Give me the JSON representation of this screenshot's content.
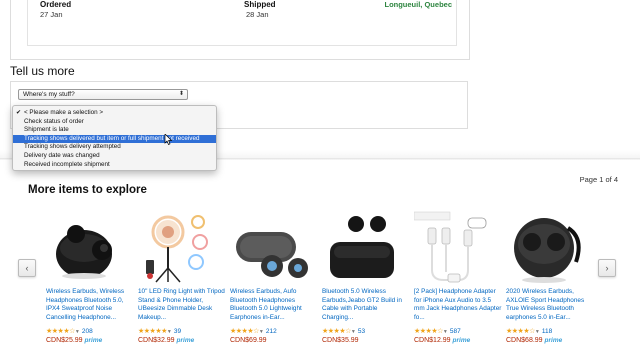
{
  "order": {
    "ordered_label": "Ordered",
    "ordered_value": "27 Jan",
    "shipped_label": "Shipped",
    "shipped_value": "28 Jan",
    "location": "Longueuil, Quebec"
  },
  "tell_us": {
    "title": "Tell us more",
    "select_value": "Where's my stuff?"
  },
  "dropdown": {
    "options": [
      "< Please make a selection >",
      "Check status of order",
      "Shipment is late",
      "Tracking shows delivered but item or full shipment not received",
      "Tracking shows delivery attempted",
      "Delivery date was changed",
      "Received incomplete shipment"
    ],
    "checked_index": 0,
    "highlighted_index": 3
  },
  "explore": {
    "title": "More items to explore",
    "page": "Page 1 of 4",
    "prev": "‹",
    "next": "›"
  },
  "products": [
    {
      "title": "Wireless Earbuds, Wireless Headphones Bluetooth 5.0, IPX4 Sweatproof Noise Cancelling Headphone...",
      "stars": "★★★★☆",
      "rating": 3.5,
      "count": "208",
      "price": "CDN$25.99",
      "prime": "prime",
      "icon": "black-earbuds-case-icon"
    },
    {
      "title": "10\" LED Ring Light with Tripod Stand & Phone Holder, UBeesize Dimmable Desk Makeup...",
      "stars": "★★★★★",
      "rating": 4.5,
      "count": "39",
      "price": "CDN$32.99",
      "prime": "prime",
      "icon": "ring-light-tripod-icon"
    },
    {
      "title": "Wireless Earbuds, Aufo Bluetooth Headphones Bluetooth 5.0 Lightweight Earphones in-Ear...",
      "stars": "★★★★☆",
      "rating": 4.0,
      "count": "212",
      "price": "CDN$69.99",
      "prime": "",
      "icon": "grey-earbuds-case-icon"
    },
    {
      "title": "Bluetooth 5.0 Wireless Earbuds,Jeabo GT2 Build in Cable with Portable Charging...",
      "stars": "★★★★☆",
      "rating": 4.0,
      "count": "53",
      "price": "CDN$35.99",
      "prime": "",
      "icon": "black-earbuds-open-case-icon"
    },
    {
      "title": "[2 Pack] Headphone Adapter for iPhone Aux Audio to 3.5 mm Jack Headphones Adapter fo...",
      "stars": "★★★★☆",
      "rating": 4.0,
      "count": "587",
      "price": "CDN$12.99",
      "prime": "prime",
      "icon": "headphone-adapter-icon"
    },
    {
      "title": "2020 Wireless Earbuds, AXLOIE Sport Headphones True Wireless Bluetooth earphones 5.0 in-Ear...",
      "stars": "★★★★☆",
      "rating": 4.0,
      "count": "118",
      "price": "CDN$68.99",
      "prime": "prime",
      "icon": "sport-earbuds-icon"
    }
  ],
  "colors": {
    "link": "#0066c0",
    "price": "#b12704",
    "star": "#f0a41b",
    "highlight": "#2f6fd6",
    "location": "#2e8540"
  }
}
